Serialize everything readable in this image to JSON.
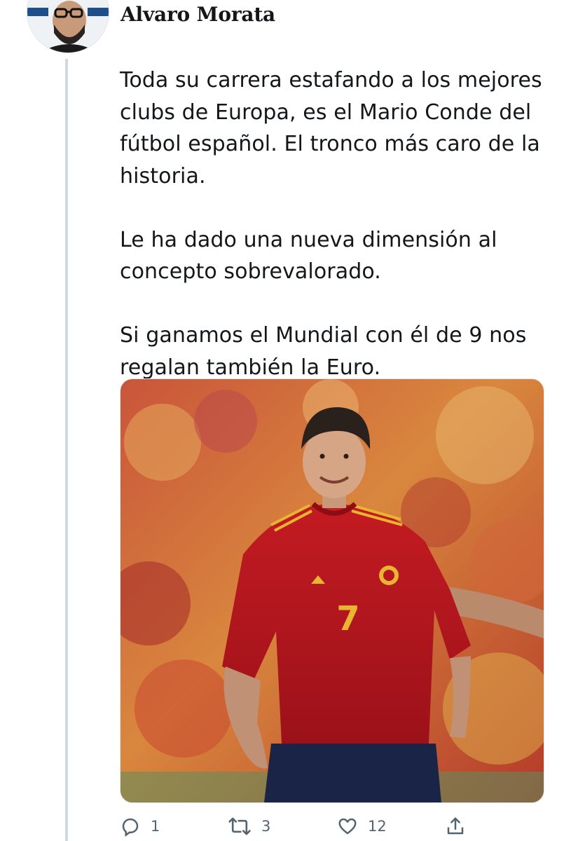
{
  "tweet": {
    "author_name": "Alvaro Morata",
    "paragraphs": [
      "Toda su carrera estafando a los mejores\nclubs de Europa, es el Mario Conde del\nfútbol español. El tronco más caro de la\nhistoria.",
      "Le ha dado una nueva dimensión al\nconcepto sobrevalorado.",
      "Si ganamos el Mundial con él de 9 nos\nregalan también la Euro."
    ],
    "media": {
      "jersey_number": "7"
    },
    "actions": {
      "reply_count": "1",
      "retweet_count": "3",
      "like_count": "12"
    }
  },
  "icons": {
    "reply": "reply-icon",
    "retweet": "retweet-icon",
    "like": "heart-icon",
    "share": "share-icon"
  },
  "colors": {
    "text": "#14171a",
    "secondary": "#536471",
    "thread_line": "#cfd9de",
    "jersey_red": "#b8141f",
    "jersey_gold": "#e8b531"
  }
}
